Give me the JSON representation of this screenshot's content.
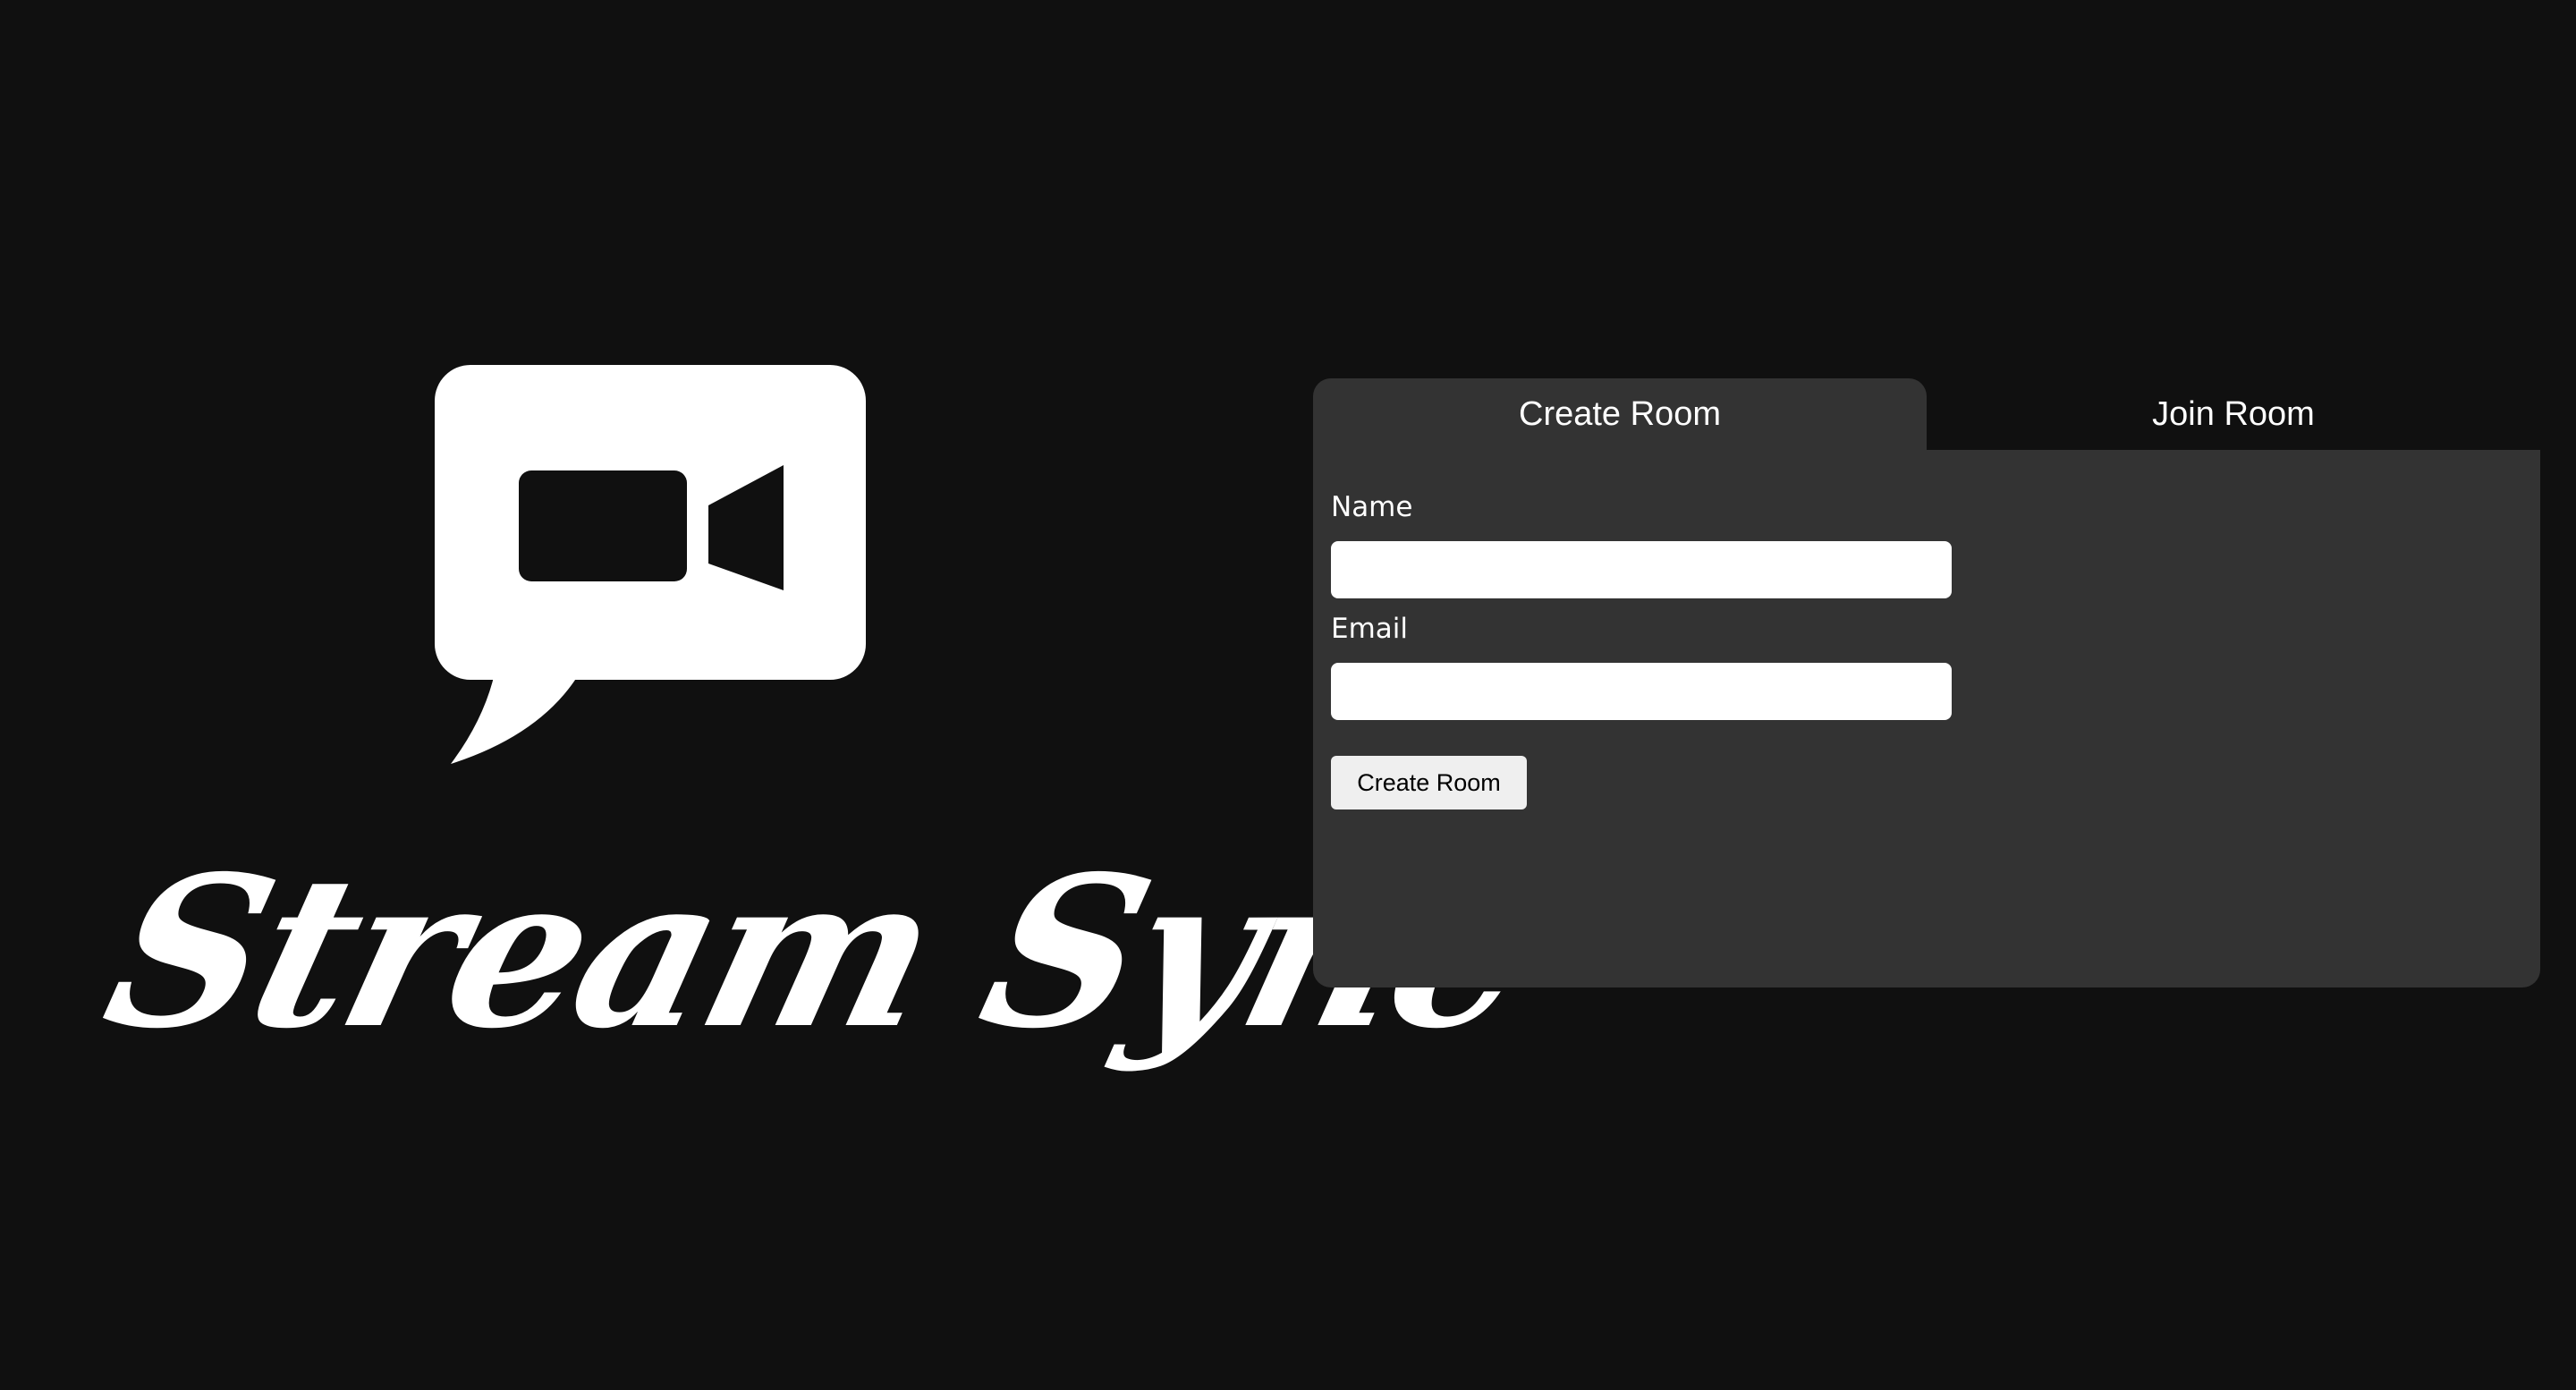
{
  "logo": {
    "icon": "video-camera-chat-bubble-icon",
    "wordmark": "Stream Sync"
  },
  "tabs": [
    {
      "label": "Create Room",
      "active": true
    },
    {
      "label": "Join Room",
      "active": false
    }
  ],
  "form": {
    "name_label": "Name",
    "name_value": "",
    "email_label": "Email",
    "email_value": "",
    "submit_label": "Create Room"
  },
  "colors": {
    "background": "#101010",
    "panel": "#333333",
    "text": "#ffffff",
    "button": "#efefef"
  }
}
